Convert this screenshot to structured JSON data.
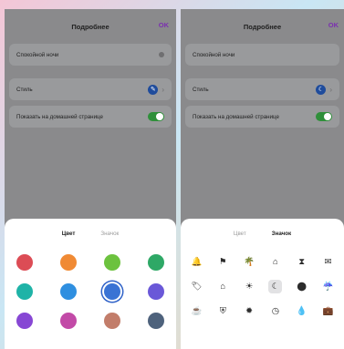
{
  "header": {
    "title": "Подробнее",
    "ok_label": "OK"
  },
  "settings": {
    "quiet_night": "Спокойной ночи",
    "style": "Стиль",
    "show_home": "Показать на домашней странице"
  },
  "tabs": {
    "color": "Цвет",
    "icon": "Значок"
  },
  "colors": {
    "swatches": [
      "#dc4c55",
      "#f08a34",
      "#6cc23e",
      "#2ea866",
      "#1fb3a7",
      "#2f8fe0",
      "#3a73d4",
      "#6a58d8",
      "#8747d4",
      "#c24aa7",
      "#c27d6a",
      "#4e627c"
    ],
    "selected_index": 6
  },
  "icons": {
    "names": [
      "bell-icon",
      "flag-icon",
      "palm-tree-icon",
      "house-icon",
      "hourglass-icon",
      "envelope-icon",
      "tag-icon",
      "house-night-icon",
      "sun-icon",
      "moon-icon",
      "location-pin-icon",
      "cloud-rain-icon",
      "coffee-cup-icon",
      "shield-icon",
      "sunlight-icon",
      "clock-icon",
      "drop-icon",
      "briefcase-icon"
    ],
    "glyphs": [
      "🔔",
      "⚑",
      "🌴",
      "⌂",
      "⧗",
      "✉",
      "🏷",
      "⌂",
      "☀",
      "☾",
      "⬤",
      "☔",
      "☕",
      "⛨",
      "✹",
      "◷",
      "💧",
      "💼"
    ],
    "selected_index": 9
  }
}
